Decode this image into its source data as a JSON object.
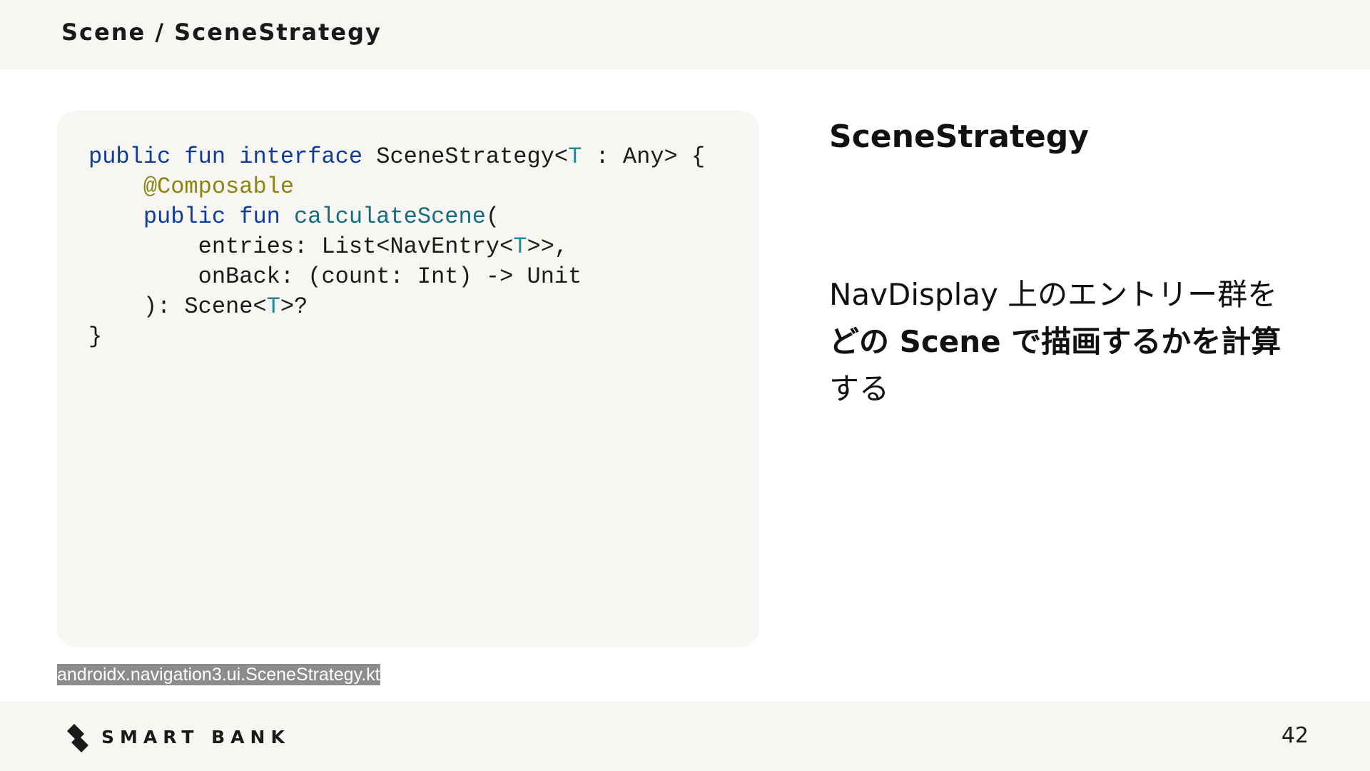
{
  "header": {
    "breadcrumb": "Scene / SceneStrategy"
  },
  "code_panel": {
    "lines": [
      [
        {
          "t": "public fun interface",
          "k": "kw"
        },
        {
          "t": " SceneStrategy<",
          "k": ""
        },
        {
          "t": "T",
          "k": "tp"
        },
        {
          "t": " : Any> {",
          "k": ""
        }
      ],
      [
        {
          "t": "    ",
          "k": ""
        },
        {
          "t": "@Composable",
          "k": "an"
        }
      ],
      [
        {
          "t": "    ",
          "k": ""
        },
        {
          "t": "public fun",
          "k": "kw"
        },
        {
          "t": " ",
          "k": ""
        },
        {
          "t": "calculateScene",
          "k": "fn"
        },
        {
          "t": "(",
          "k": ""
        }
      ],
      [
        {
          "t": "        entries: List<NavEntry<",
          "k": ""
        },
        {
          "t": "T",
          "k": "tp"
        },
        {
          "t": ">>,",
          "k": ""
        }
      ],
      [
        {
          "t": "        onBack: (count: Int) -> Unit",
          "k": ""
        }
      ],
      [
        {
          "t": "    ): Scene<",
          "k": ""
        },
        {
          "t": "T",
          "k": "tp"
        },
        {
          "t": ">?",
          "k": ""
        }
      ],
      [
        {
          "t": "}",
          "k": ""
        }
      ]
    ],
    "source": "androidx.navigation3.ui.SceneStrategy.kt"
  },
  "content": {
    "heading": "SceneStrategy",
    "desc_line1": "NavDisplay 上のエントリー群を",
    "desc_line2": "どの Scene で描画するかを計算",
    "desc_line3": "する"
  },
  "footer": {
    "logo_text": "SMART BANK",
    "page_number": "42"
  },
  "colors": {
    "keyword": "#0d3c9a",
    "function": "#1a6b7a",
    "type_param": "#1f8a99",
    "annotation": "#8b8415",
    "panel_bg": "#f7f6f2"
  }
}
